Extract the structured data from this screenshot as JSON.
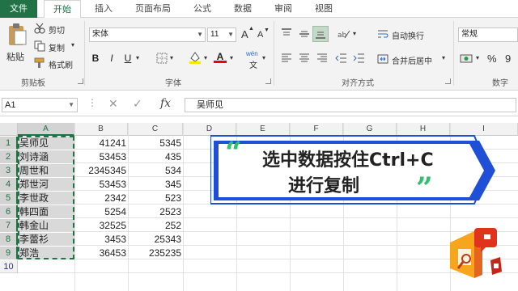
{
  "tabs": [
    "文件",
    "开始",
    "插入",
    "页面布局",
    "公式",
    "数据",
    "审阅",
    "视图"
  ],
  "ribbon": {
    "clipboard": {
      "paste": "粘贴",
      "cut": "剪切",
      "copy": "复制",
      "format_painter": "格式刷",
      "label": "剪贴板"
    },
    "font": {
      "name": "宋体",
      "size": "11",
      "grow": "A",
      "shrink": "A",
      "bold": "B",
      "italic": "I",
      "underline": "U",
      "font_color": "A",
      "phonetic": "wén",
      "label": "字体"
    },
    "alignment": {
      "wrap": "自动换行",
      "merge": "合并后居中",
      "label": "对齐方式"
    },
    "number": {
      "format": "常规",
      "percent": "%",
      "comma": "9",
      "label": "数字"
    }
  },
  "formula_bar": {
    "name_box": "A1",
    "fx": "fx",
    "value": "吴师见"
  },
  "grid": {
    "columns": [
      "A",
      "B",
      "C",
      "D",
      "E",
      "F",
      "G",
      "H",
      "I"
    ],
    "rows": [
      {
        "num": "1",
        "a": "吴师见",
        "b": "41241",
        "c": "5345"
      },
      {
        "num": "2",
        "a": "刘诗涵",
        "b": "53453",
        "c": "435"
      },
      {
        "num": "3",
        "a": "周世和",
        "b": "2345345",
        "c": "534"
      },
      {
        "num": "4",
        "a": "郑世河",
        "b": "53453",
        "c": "345"
      },
      {
        "num": "5",
        "a": "李世政",
        "b": "2342",
        "c": "523"
      },
      {
        "num": "6",
        "a": "韩四面",
        "b": "5254",
        "c": "2523"
      },
      {
        "num": "7",
        "a": "韩金山",
        "b": "32525",
        "c": "252"
      },
      {
        "num": "8",
        "a": "李蕾衫",
        "b": "3453",
        "c": "25343"
      },
      {
        "num": "9",
        "a": "郑浩",
        "b": "36453",
        "c": "235235"
      },
      {
        "num": "10",
        "a": "",
        "b": "",
        "c": ""
      }
    ]
  },
  "banner": {
    "line1": "选中数据按住Ctrl+C",
    "line2": "进行复制",
    "open_quote": "“",
    "close_quote": "”"
  },
  "colors": {
    "accent": "#217346",
    "selection_fill": "#d9d9d9",
    "quote_green": "#2fbf73",
    "banner_blue": "#1f4fd6"
  }
}
